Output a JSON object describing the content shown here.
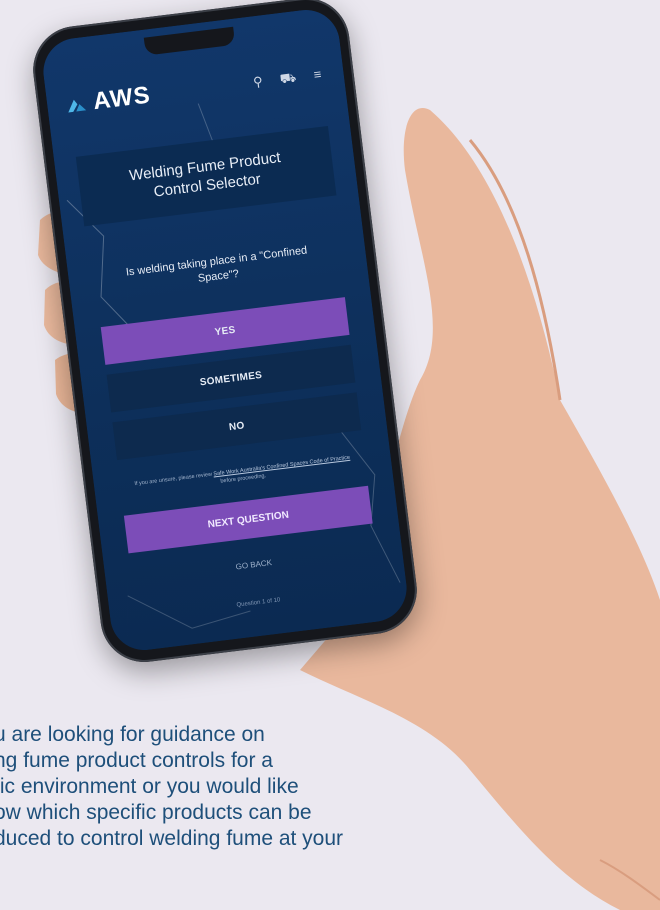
{
  "app": {
    "logo_text": "AWS"
  },
  "header": {
    "icons": [
      "search-icon",
      "cart-icon",
      "menu-icon"
    ],
    "search_glyph": "⚲",
    "cart_glyph": "⛟",
    "menu_glyph": "≡"
  },
  "card": {
    "title": "Welding Fume Product Control Selector"
  },
  "question": {
    "text": "Is welding taking place in a \"Confined Space\"?"
  },
  "options": [
    {
      "label": "YES",
      "selected": true
    },
    {
      "label": "SOMETIMES",
      "selected": false
    },
    {
      "label": "NO",
      "selected": false
    }
  ],
  "note": {
    "prefix": "If you are unsure, please review ",
    "link": "Safe Work Australia's Confined Spaces Code of Practice",
    "suffix": " before proceeding."
  },
  "actions": {
    "next": "NEXT QUESTION",
    "back": "GO BACK"
  },
  "progress": {
    "text": "Question 1 of 10"
  },
  "caption": {
    "lines": [
      "u are looking for guidance on",
      "ng fume product controls for a",
      "fic environment or you would like",
      "ow which specific products can be",
      "duced to control welding fume at your"
    ]
  },
  "colors": {
    "screen": "#0f3460",
    "accent": "#7c4db8",
    "caption": "#1e4f7a",
    "background": "#ebe8f0"
  }
}
